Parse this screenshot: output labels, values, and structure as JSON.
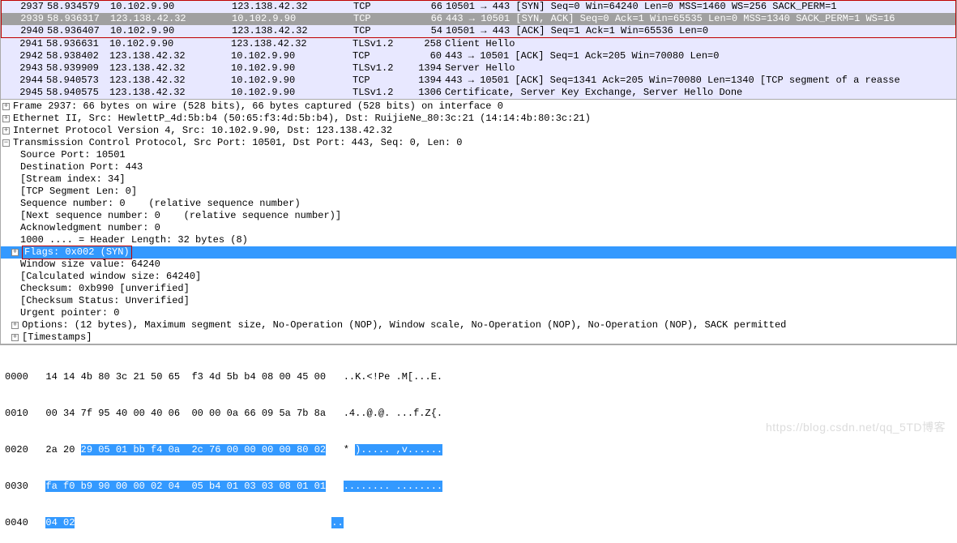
{
  "packets": [
    {
      "no": "2937",
      "time": "58.934579",
      "src": "10.102.9.90",
      "dst": "123.138.42.32",
      "proto": "TCP",
      "len": "66",
      "info": "10501 → 443 [SYN] Seq=0 Win=64240 Len=0 MSS=1460 WS=256 SACK_PERM=1",
      "cls": "row-light",
      "red": true
    },
    {
      "no": "2939",
      "time": "58.936317",
      "src": "123.138.42.32",
      "dst": "10.102.9.90",
      "proto": "TCP",
      "len": "66",
      "info": "443 → 10501 [SYN, ACK] Seq=0 Ack=1 Win=65535 Len=0 MSS=1340 SACK_PERM=1 WS=16",
      "cls": "row-sel",
      "red": true
    },
    {
      "no": "2940",
      "time": "58.936407",
      "src": "10.102.9.90",
      "dst": "123.138.42.32",
      "proto": "TCP",
      "len": "54",
      "info": "10501 → 443 [ACK] Seq=1 Ack=1 Win=65536 Len=0",
      "cls": "row-light",
      "red": true
    },
    {
      "no": "2941",
      "time": "58.936631",
      "src": "10.102.9.90",
      "dst": "123.138.42.32",
      "proto": "TLSv1.2",
      "len": "258",
      "info": "Client Hello",
      "cls": "row-light",
      "red": false
    },
    {
      "no": "2942",
      "time": "58.938402",
      "src": "123.138.42.32",
      "dst": "10.102.9.90",
      "proto": "TCP",
      "len": "60",
      "info": "443 → 10501 [ACK] Seq=1 Ack=205 Win=70080 Len=0",
      "cls": "row-light",
      "red": false
    },
    {
      "no": "2943",
      "time": "58.939909",
      "src": "123.138.42.32",
      "dst": "10.102.9.90",
      "proto": "TLSv1.2",
      "len": "1394",
      "info": "Server Hello",
      "cls": "row-light",
      "red": false
    },
    {
      "no": "2944",
      "time": "58.940573",
      "src": "123.138.42.32",
      "dst": "10.102.9.90",
      "proto": "TCP",
      "len": "1394",
      "info": "443 → 10501 [ACK] Seq=1341 Ack=205 Win=70080 Len=1340 [TCP segment of a reasse",
      "cls": "row-light",
      "red": false
    },
    {
      "no": "2945",
      "time": "58.940575",
      "src": "123.138.42.32",
      "dst": "10.102.9.90",
      "proto": "TLSv1.2",
      "len": "1306",
      "info": "Certificate, Server Key Exchange, Server Hello Done",
      "cls": "row-light",
      "red": false
    }
  ],
  "tree": {
    "frame": "Frame 2937: 66 bytes on wire (528 bits), 66 bytes captured (528 bits) on interface 0",
    "eth": "Ethernet II, Src: HewlettP_4d:5b:b4 (50:65:f3:4d:5b:b4), Dst: RuijieNe_80:3c:21 (14:14:4b:80:3c:21)",
    "ip": "Internet Protocol Version 4, Src: 10.102.9.90, Dst: 123.138.42.32",
    "tcp": "Transmission Control Protocol, Src Port: 10501, Dst Port: 443, Seq: 0, Len: 0",
    "srcport": "Source Port: 10501",
    "dstport": "Destination Port: 443",
    "stream": "[Stream index: 34]",
    "seglen": "[TCP Segment Len: 0]",
    "seqnum": "Sequence number: 0    (relative sequence number)",
    "nextseq": "[Next sequence number: 0    (relative sequence number)]",
    "acknum": "Acknowledgment number: 0",
    "hdrlen": "1000 .... = Header Length: 32 bytes (8)",
    "flags": "Flags: 0x002 (SYN)",
    "winsize": "Window size value: 64240",
    "calcwin": "[Calculated window size: 64240]",
    "cksum": "Checksum: 0xb990 [unverified]",
    "ckstat": "[Checksum Status: Unverified]",
    "urgent": "Urgent pointer: 0",
    "options": "Options: (12 bytes), Maximum segment size, No-Operation (NOP), Window scale, No-Operation (NOP), No-Operation (NOP), SACK permitted",
    "timestamps": "[Timestamps]"
  },
  "hex": {
    "r0o": "0000",
    "r0h": "14 14 4b 80 3c 21 50 65  f3 4d 5b b4 08 00 45 00",
    "r0a": "..K.<!Pe .M[...E.",
    "r1o": "0010",
    "r1h": "00 34 7f 95 40 00 40 06  00 00 0a 66 09 5a 7b 8a",
    "r1a": ".4..@.@. ...f.Z{.",
    "r2o": "0020",
    "r2h1": "2a 20 ",
    "r2h2": "29 05 01 bb f4 0a  2c 76 00 00 00 00 80 02",
    "r2a1": "* ",
    "r2a2": ")..... ,v......",
    "r3o": "0030",
    "r3h": "fa f0 b9 90 00 00 02 04  05 b4 01 03 03 08 01 01",
    "r3a": "........ ........",
    "r4o": "0040",
    "r4h": "04 02",
    "r4a": ".."
  },
  "watermark": "https://blog.csdn.net/qq_5TD博客"
}
